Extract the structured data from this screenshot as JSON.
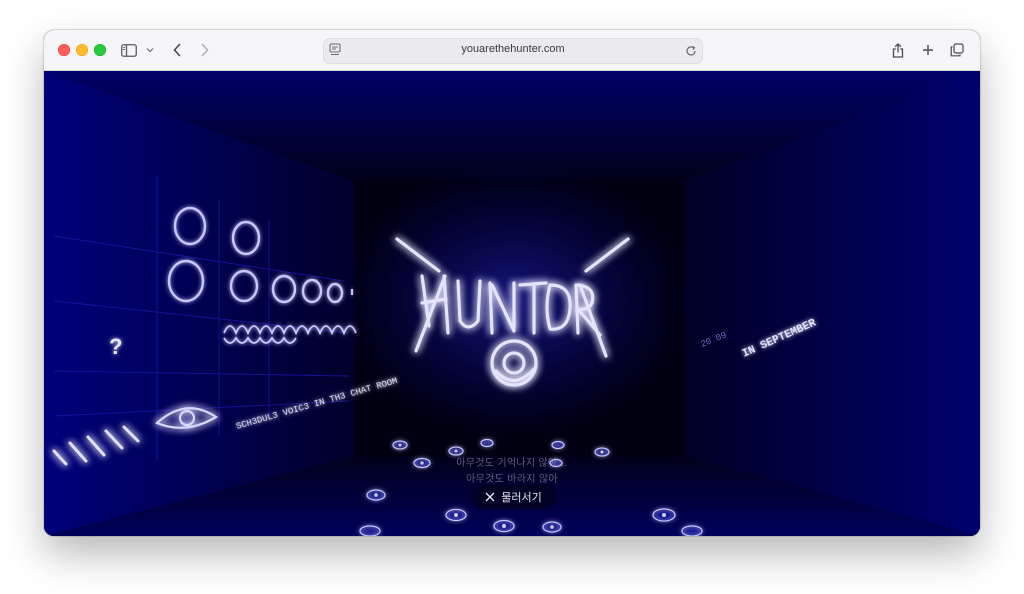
{
  "browser": {
    "url": "youarethehunter.com",
    "colors": {
      "toolbar": "#f6f5f7",
      "url_bar": "#ebeaec"
    },
    "icons": [
      "sidebar-icon",
      "chevron-down-icon",
      "back-icon",
      "forward-icon",
      "reader-icon",
      "reload-icon",
      "share-icon",
      "plus-icon",
      "tabs-icon"
    ]
  },
  "scene": {
    "logo": "HUNTER",
    "left_wall_text": "SCH3DUL3 VOIC3 IN TH3 CHAT ROOM",
    "right_wall_date": "IN SEPTEMBER",
    "right_wall_small": "20 09",
    "question_mark": "?",
    "colors": {
      "glow": "#c8c8ff",
      "deep_blue": "#00005a",
      "accent": "#4848ff"
    }
  },
  "message": {
    "line1": "아무것도 기억나지 않아…",
    "line2": "아무것도 바라지 않아"
  },
  "retreat_button": {
    "label": "물러서기"
  }
}
